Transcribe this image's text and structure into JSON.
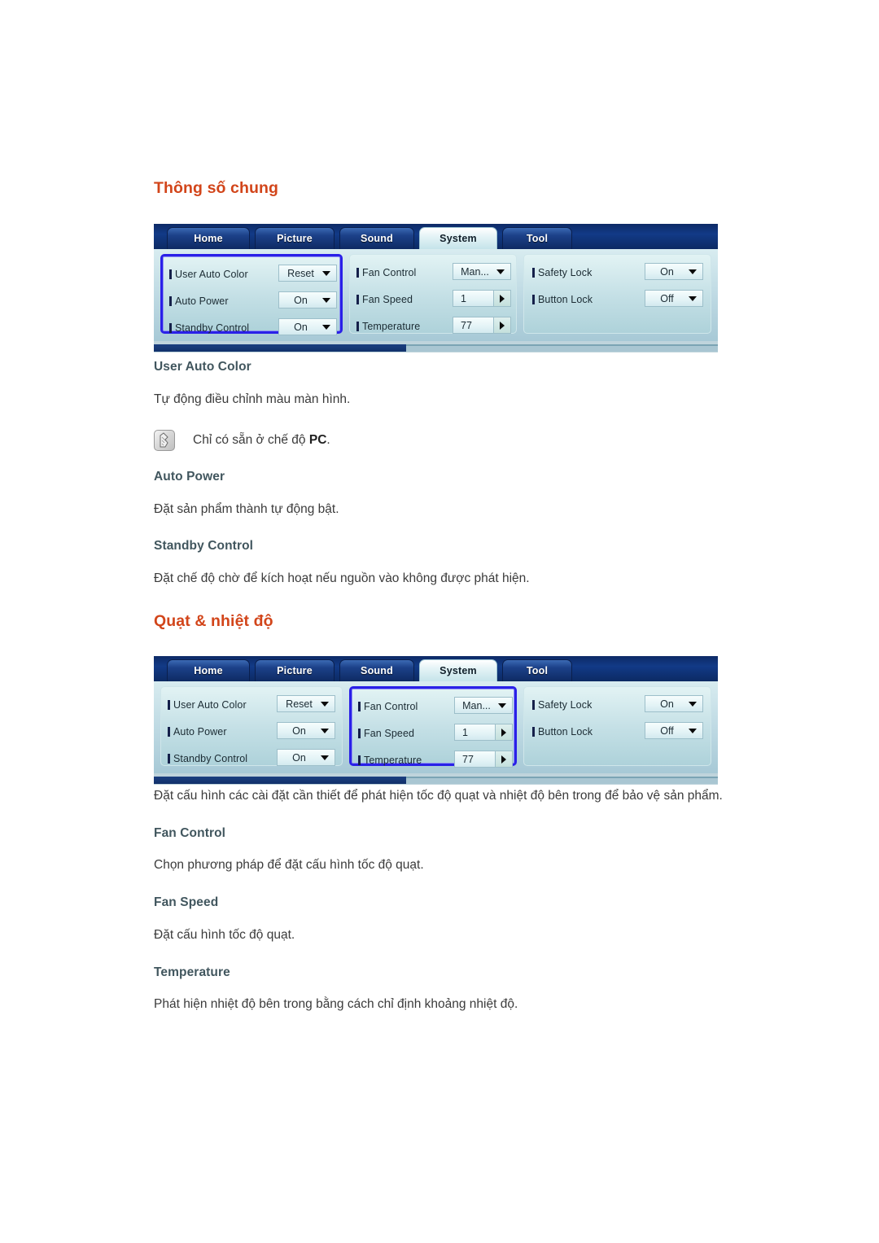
{
  "document": {
    "sections": [
      {
        "heading": "Thông số chung",
        "osd": {
          "tabs": [
            {
              "label": "Home",
              "active": false
            },
            {
              "label": "Picture",
              "active": false
            },
            {
              "label": "Sound",
              "active": false
            },
            {
              "label": "System",
              "active": true
            },
            {
              "label": "Tool",
              "active": false
            }
          ],
          "columns": [
            {
              "selected": true,
              "rows": [
                {
                  "label": "User Auto Color",
                  "value": "Reset",
                  "control": "dropdown"
                },
                {
                  "label": "Auto Power",
                  "value": "On",
                  "control": "dropdown"
                },
                {
                  "label": "Standby Control",
                  "value": "On",
                  "control": "dropdown"
                }
              ]
            },
            {
              "selected": false,
              "rows": [
                {
                  "label": "Fan Control",
                  "value": "Man...",
                  "control": "dropdown"
                },
                {
                  "label": "Fan Speed",
                  "value": "1",
                  "control": "spinner"
                },
                {
                  "label": "Temperature",
                  "value": "77",
                  "control": "spinner"
                }
              ]
            },
            {
              "selected": false,
              "rows": [
                {
                  "label": "Safety Lock",
                  "value": "On",
                  "control": "dropdown"
                },
                {
                  "label": "Button Lock",
                  "value": "Off",
                  "control": "dropdown"
                }
              ]
            }
          ]
        },
        "items": [
          {
            "title": "User Auto Color",
            "body": "Tự động điều chỉnh màu màn hình.",
            "note": {
              "prefix": "Chỉ có sẵn ở chế độ ",
              "strong": "PC",
              "suffix": "."
            }
          },
          {
            "title": "Auto Power",
            "body": "Đặt sản phẩm thành tự động bật."
          },
          {
            "title": "Standby Control",
            "body": "Đặt chế độ chờ để kích hoạt nếu nguồn vào không được phát hiện."
          }
        ]
      },
      {
        "heading": "Quạt & nhiệt độ",
        "osd": {
          "tabs": [
            {
              "label": "Home",
              "active": false
            },
            {
              "label": "Picture",
              "active": false
            },
            {
              "label": "Sound",
              "active": false
            },
            {
              "label": "System",
              "active": true
            },
            {
              "label": "Tool",
              "active": false
            }
          ],
          "columns": [
            {
              "selected": false,
              "rows": [
                {
                  "label": "User Auto Color",
                  "value": "Reset",
                  "control": "dropdown"
                },
                {
                  "label": "Auto Power",
                  "value": "On",
                  "control": "dropdown"
                },
                {
                  "label": "Standby Control",
                  "value": "On",
                  "control": "dropdown"
                }
              ]
            },
            {
              "selected": true,
              "rows": [
                {
                  "label": "Fan Control",
                  "value": "Man...",
                  "control": "dropdown"
                },
                {
                  "label": "Fan Speed",
                  "value": "1",
                  "control": "spinner"
                },
                {
                  "label": "Temperature",
                  "value": "77",
                  "control": "spinner"
                }
              ]
            },
            {
              "selected": false,
              "rows": [
                {
                  "label": "Safety Lock",
                  "value": "On",
                  "control": "dropdown"
                },
                {
                  "label": "Button Lock",
                  "value": "Off",
                  "control": "dropdown"
                }
              ]
            }
          ]
        },
        "intro": "Đặt cấu hình các cài đặt cần thiết để phát hiện tốc độ quạt và nhiệt độ bên trong để bảo vệ sản phẩm.",
        "items": [
          {
            "title": "Fan Control",
            "body": "Chọn phương pháp để đặt cấu hình tốc độ quạt."
          },
          {
            "title": "Fan Speed",
            "body": "Đặt cấu hình tốc độ quạt."
          },
          {
            "title": "Temperature",
            "body": "Phát hiện nhiệt độ bên trong bằng cách chỉ định khoảng nhiệt độ."
          }
        ]
      }
    ],
    "colors": {
      "section_heading": "#d2451a",
      "sub_heading": "#41565e",
      "body_text": "#3b3b3b",
      "osd_tabbar": "#123a87",
      "osd_selection": "#2a20e8"
    }
  }
}
